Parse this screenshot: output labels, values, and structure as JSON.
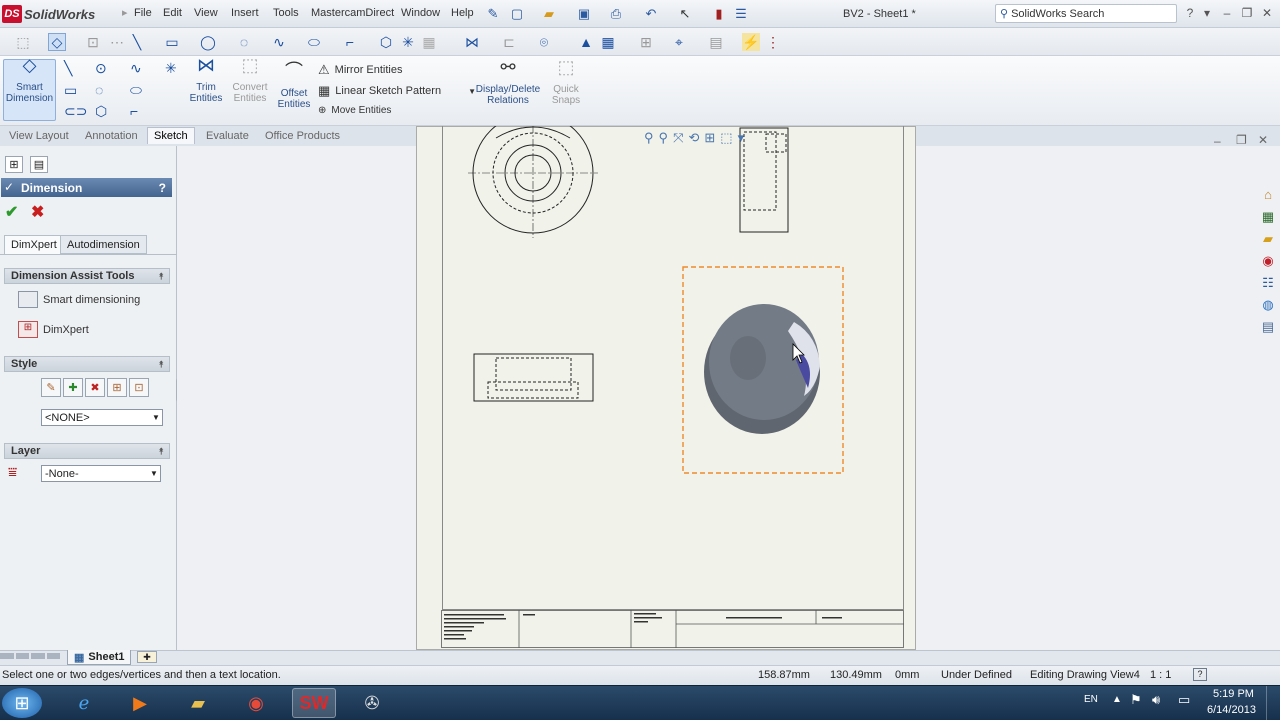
{
  "app": {
    "name": "SolidWorks",
    "badge": "DS"
  },
  "menu": [
    "File",
    "Edit",
    "View",
    "Insert",
    "Tools",
    "MastercamDirect",
    "Window",
    "Help"
  ],
  "document_title": "BV2 - Sheet1 *",
  "search": {
    "placeholder": "SolidWorks Search"
  },
  "command_manager": {
    "smart_dimension": "Smart Dimension",
    "trim_entities": "Trim Entities",
    "convert_entities": "Convert Entities",
    "offset_entities": "Offset Entities",
    "mirror_entities": "Mirror Entities",
    "linear_sketch_pattern": "Linear Sketch Pattern",
    "move_entities": "Move Entities",
    "display_delete_relations": "Display/Delete Relations",
    "quick_snaps": "Quick Snaps"
  },
  "tabs": [
    "View Layout",
    "Annotation",
    "Sketch",
    "Evaluate",
    "Office Products"
  ],
  "active_tab": "Sketch",
  "property_manager": {
    "title": "Dimension",
    "help": "?",
    "tabs": [
      "DimXpert",
      "Autodimension"
    ],
    "sections": {
      "assist_tools": {
        "title": "Dimension Assist Tools",
        "items": [
          "Smart dimensioning",
          "DimXpert"
        ]
      },
      "style": {
        "title": "Style",
        "value": "<NONE>"
      },
      "layer": {
        "title": "Layer",
        "value": "-None-"
      }
    }
  },
  "sheet_tab": "Sheet1",
  "status": {
    "message": "Select one or two edges/vertices and then a text location.",
    "x": "158.87mm",
    "y": "130.49mm",
    "z": "0mm",
    "state": "Under Defined",
    "editing": "Editing Drawing View4",
    "scale": "1 : 1"
  },
  "taskbar": {
    "language": "EN",
    "time": "5:19 PM",
    "date": "6/14/2013"
  },
  "colors": {
    "accent": "#43648f",
    "model": "#6d7480",
    "selection": "#f0a040"
  }
}
